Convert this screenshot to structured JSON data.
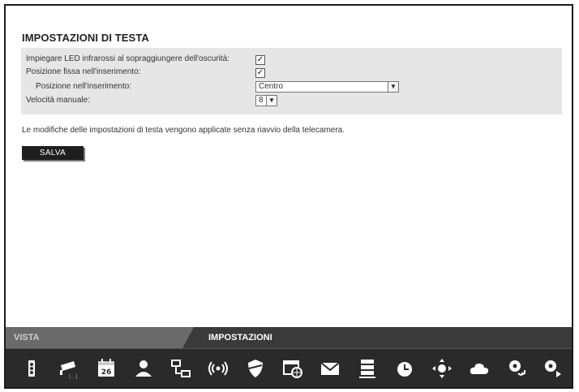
{
  "page": {
    "title": "IMPOSTAZIONI DI TESTA",
    "note": "Le modifiche delle impostazioni di testa vengono applicate senza riavvio della telecamera.",
    "save_label": "SALVA"
  },
  "settings": [
    {
      "label": "Impiegare LED infrarossi al sopraggiungere dell'oscurità:",
      "type": "checkbox",
      "checked": true,
      "indent": false
    },
    {
      "label": "Posizione fissa nell'inserimento:",
      "type": "checkbox",
      "checked": true,
      "indent": false
    },
    {
      "label": "Posizione nell'inserimento:",
      "type": "select",
      "value": "Centro",
      "indent": true
    },
    {
      "label": "Velocità manuale:",
      "type": "select",
      "value": "8",
      "indent": false
    }
  ],
  "tabs": {
    "vista": "VISTA",
    "impostazioni": "IMPOSTAZIONI",
    "active": "impostazioni"
  },
  "toolbar_icons": [
    "camera-device-icon",
    "camera-list-icon",
    "calendar-icon",
    "user-icon",
    "network-icon",
    "wireless-icon",
    "security-shield-icon",
    "web-browser-icon",
    "email-icon",
    "server-storage-icon",
    "alarm-clock-icon",
    "pan-tilt-icon",
    "cloud-icon",
    "settings-update-icon",
    "settings-next-icon"
  ],
  "calendar_day": "26",
  "colors": {
    "panel_bg": "#e6e6e6",
    "tabbar_bg": "#3a3a3a",
    "iconbar_bg": "#2a2a2a",
    "button_bg": "#1e1e1e"
  }
}
